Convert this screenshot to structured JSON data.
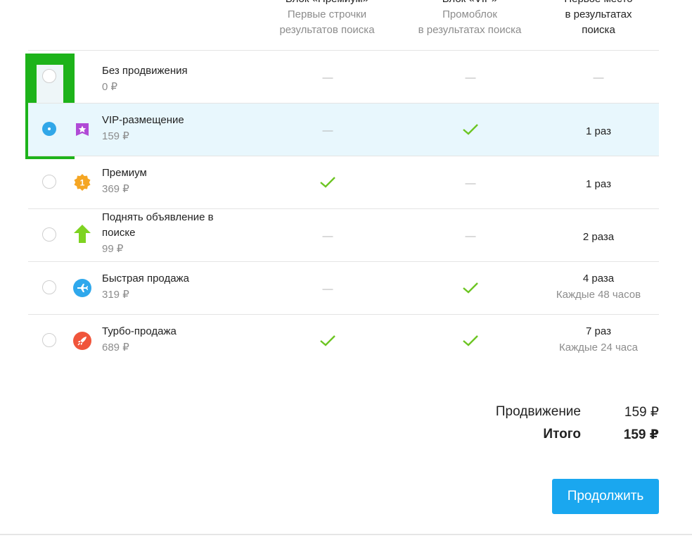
{
  "columns": [
    {
      "title": "Блок «Премиум»",
      "sub": [
        "Первые строчки",
        "результатов поиска"
      ]
    },
    {
      "title": "Блок «VIP»",
      "sub": [
        "Промоблок",
        "в результатах поиска"
      ]
    },
    {
      "title": "Первое место",
      "sub": [
        "в результатах",
        "поиска"
      ]
    }
  ],
  "dash": "—",
  "options": [
    {
      "name": "Без продвижения",
      "price": "0 ₽",
      "icon": "none",
      "c1": "dash",
      "c2": "dash",
      "c3": "dash",
      "count": "",
      "note": ""
    },
    {
      "name": "VIP-размещение",
      "price": "159 ₽",
      "icon": "star-icon",
      "c1": "dash",
      "c2": "check",
      "c3": "count",
      "count": "1 раз",
      "note": ""
    },
    {
      "name": "Премиум",
      "price": "369 ₽",
      "icon": "medal-icon",
      "c1": "check",
      "c2": "dash",
      "c3": "count",
      "count": "1 раз",
      "note": ""
    },
    {
      "name": "Поднять объявление в поиске",
      "price": "99 ₽",
      "icon": "arrow-up-icon",
      "c1": "dash",
      "c2": "dash",
      "c3": "count",
      "count": "2 раза",
      "note": ""
    },
    {
      "name": "Быстрая продажа",
      "price": "319 ₽",
      "icon": "airplane-icon",
      "c1": "dash",
      "c2": "check",
      "c3": "count",
      "count": "4 раза",
      "note": "Каждые 48 часов"
    },
    {
      "name": "Турбо-продажа",
      "price": "689 ₽",
      "icon": "rocket-icon",
      "c1": "check",
      "c2": "check",
      "c3": "count",
      "count": "7 раз",
      "note": "Каждые 24 часа"
    }
  ],
  "badges": {
    "medal_digit": "1"
  },
  "totals": {
    "promo_label": "Продвижение",
    "promo_value": "159 ₽",
    "total_label": "Итого",
    "total_value": "159 ₽"
  },
  "continue_label": "Продолжить",
  "colors": {
    "accent": "#1aa7ef",
    "check": "#6cc522",
    "selected_row": "#e8f7fd",
    "highlight": "#1db31a"
  }
}
